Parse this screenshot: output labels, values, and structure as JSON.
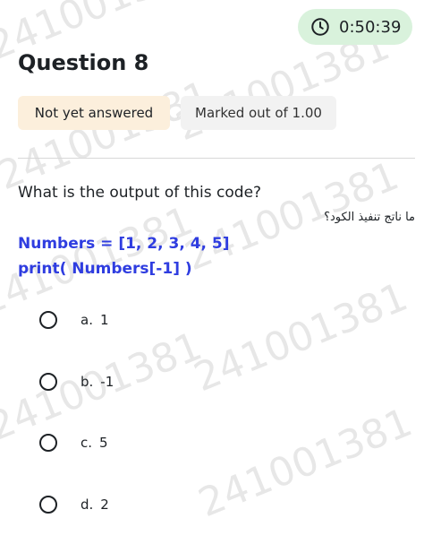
{
  "timer": {
    "icon": "clock-icon",
    "value": "0:50:39",
    "color": "#d9f2dc"
  },
  "question": {
    "title": "Question 8",
    "state": "Not yet answered",
    "grade": "Marked out of 1.00",
    "text": "What is the output of this code?",
    "text_ar": "ما ناتج تنفيذ الكود؟",
    "code": [
      "Numbers = [1, 2, 3, 4, 5]",
      "print( Numbers[-1] )"
    ]
  },
  "options": [
    {
      "letter": "a.",
      "value": "1"
    },
    {
      "letter": "b.",
      "value": "-1"
    },
    {
      "letter": "c.",
      "value": "5"
    },
    {
      "letter": "d.",
      "value": "2"
    }
  ],
  "watermark": "241001381",
  "colors": {
    "code": "#2f3de0",
    "state_badge": "#fcefdc",
    "grade_badge": "#f2f2f2"
  }
}
